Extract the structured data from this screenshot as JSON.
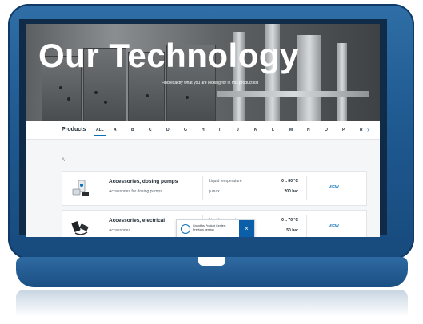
{
  "hero": {
    "title": "Our Technology",
    "subtitle": "Find exactly what you are looking for in this product list"
  },
  "nav": {
    "products_label": "Products",
    "letters": [
      "ALL",
      "A",
      "B",
      "C",
      "D",
      "G",
      "H",
      "I",
      "J",
      "K",
      "L",
      "M",
      "N",
      "O",
      "P",
      "R"
    ],
    "active_letter": "ALL",
    "next_icon": "chevron-right-icon"
  },
  "section": {
    "letter": "A"
  },
  "products": [
    {
      "name": "Accessories, dosing pumps",
      "category": "Accessories for dosing pumps",
      "spec1_label": "Liquid temperature",
      "spec1_value": "0 .. 80 °C",
      "spec2_label": "p max",
      "spec2_value": "200 bar",
      "action": "VIEW",
      "icon": "dosing-pump-accessory-icon"
    },
    {
      "name": "Accessories, electrical",
      "category": "Accessories",
      "spec1_label": "Liquid temperature",
      "spec1_value": "0 .. 70 °C",
      "spec2_label": "",
      "spec2_value": "50 bar",
      "action": "VIEW",
      "icon": "electrical-accessory-icon"
    }
  ],
  "toast": {
    "text": "Grundfos Product Center - Previous version",
    "close": "×"
  },
  "colors": {
    "frame": "#1f5a91",
    "accent": "#0b6fb8"
  }
}
